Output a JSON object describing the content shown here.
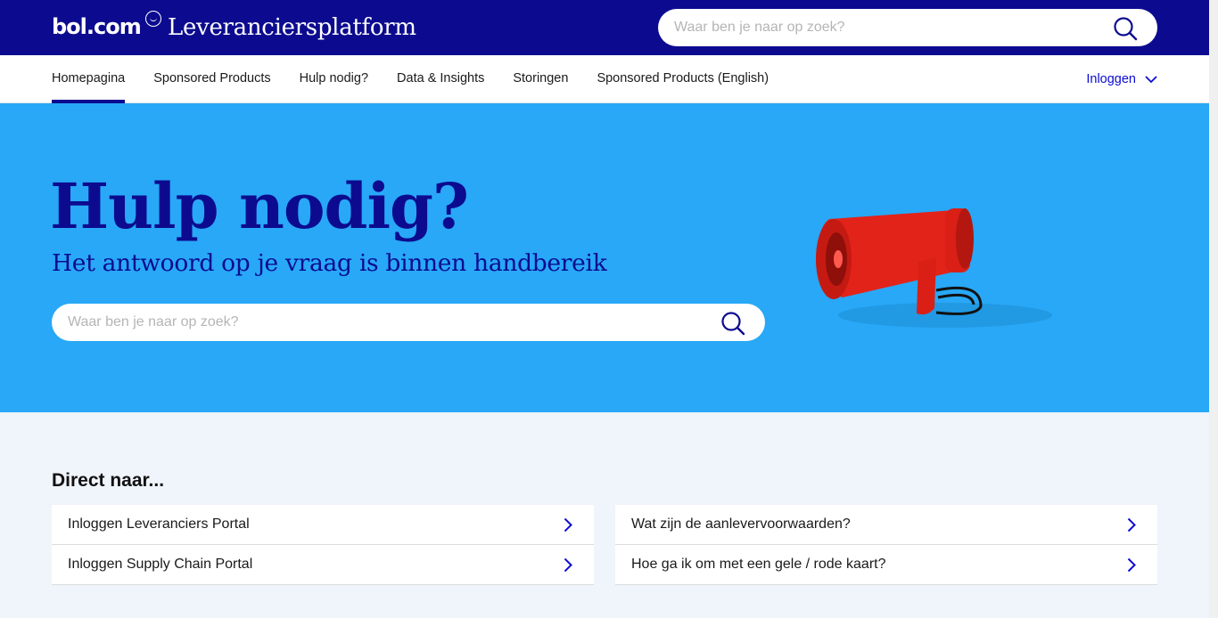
{
  "header": {
    "logo_text": "bol.com",
    "platform_title": "Leveranciersplatform",
    "search_placeholder": "Waar ben je naar op zoek?"
  },
  "nav": {
    "items": [
      {
        "label": "Homepagina",
        "active": true
      },
      {
        "label": "Sponsored Products"
      },
      {
        "label": "Hulp nodig?"
      },
      {
        "label": "Data & Insights"
      },
      {
        "label": "Storingen"
      },
      {
        "label": "Sponsored Products (English)"
      }
    ],
    "login_label": "Inloggen"
  },
  "hero": {
    "title": "Hulp nodig?",
    "subtitle": "Het antwoord op je vraag is binnen handbereik",
    "search_placeholder": "Waar ben je naar op zoek?"
  },
  "direct": {
    "heading": "Direct naar...",
    "left_links": [
      {
        "label": "Inloggen Leveranciers Portal"
      },
      {
        "label": "Inloggen Supply Chain Portal"
      }
    ],
    "right_links": [
      {
        "label": "Wat zijn de aanlevervoorwaarden?"
      },
      {
        "label": "Hoe ga ik om met een gele / rode kaart?"
      }
    ]
  },
  "colors": {
    "brand_dark": "#0c0b8f",
    "hero_bg": "#28a8f7",
    "link_blue": "#0c0bd4",
    "page_bg": "#f0f4fb"
  }
}
